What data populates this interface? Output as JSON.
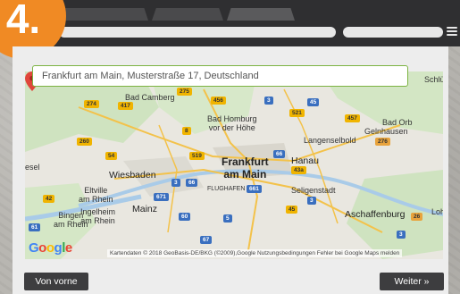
{
  "step": {
    "number": "4."
  },
  "search": {
    "value": "Frankfurt am Main, Musterstraße 17, Deutschland"
  },
  "map": {
    "places": {
      "bad_camberg": "Bad Camberg",
      "bad_homburg": "Bad Homburg\nvor der Höhe",
      "gelnhausen": "Gelnhausen",
      "langenselbold": "Langenselbold",
      "bad_orb": "Bad Orb",
      "frankfurt": "Frankfurt\nam Main",
      "hanau": "Hanau",
      "wiesbaden": "Wiesbaden",
      "eltville": "Eltville\nam Rhein",
      "mainz": "Mainz",
      "flughafen": "FLUGHAFEN",
      "seligenstadt": "Seligenstadt",
      "ingelheim": "Ingelheim\nam Rhein",
      "bingen": "Bingen\nam Rhein",
      "aschaffenburg": "Aschaffenburg",
      "lohr": "Loh",
      "schluchtern": "Schlü",
      "wetzlar_edge": "esel",
      "rpa": "RPA"
    },
    "shields": {
      "s275": "275",
      "s456": "456",
      "s274": "274",
      "s417": "417",
      "s3a": "3",
      "s45a": "45",
      "s521": "521",
      "s457": "457",
      "s8": "8",
      "s260": "260",
      "s54": "54",
      "s519": "519",
      "s66a": "66",
      "s66b": "66",
      "s276": "276",
      "s43a": "43a",
      "s3b": "3",
      "s66c": "66",
      "s671": "671",
      "s661": "661",
      "s3c": "3",
      "s45b": "45",
      "s42": "42",
      "s60": "60",
      "s5": "5",
      "s3d": "3",
      "s26": "26",
      "s67": "67",
      "s61": "61"
    },
    "google": "Google",
    "attribution": "Kartendaten © 2018 GeoBasis-DE/BKG (©2009),Google   Nutzungsbedingungen   Fehler bei Google Maps melden"
  },
  "buttons": {
    "back": "Von vorne",
    "next": "Weiter »"
  },
  "colors": {
    "accent": "#f08a24",
    "search_border": "#7cb342",
    "topbar": "#2f2f31",
    "button": "#3d3d3f"
  }
}
